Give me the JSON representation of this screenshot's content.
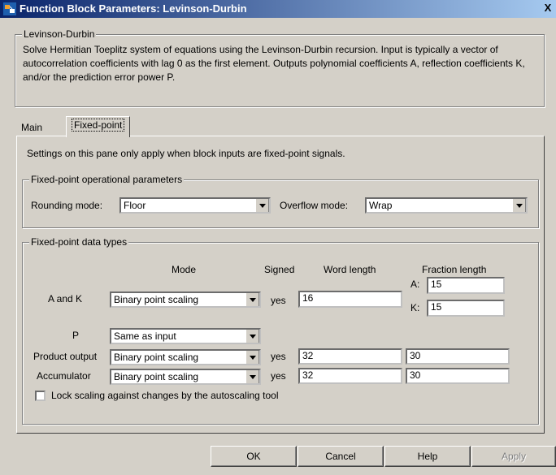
{
  "window": {
    "title": "Function Block Parameters: Levinson-Durbin",
    "close_glyph": "X"
  },
  "block": {
    "group_label": "Levinson-Durbin",
    "description": "Solve Hermitian Toeplitz system of equations using the Levinson-Durbin recursion.  Input is typically a vector of autocorrelation coefficients with lag 0 as the first element.  Outputs polynomial coefficients A, reflection coefficients K, and/or the prediction error power P."
  },
  "tabs": [
    {
      "label": "Main",
      "active": false
    },
    {
      "label": "Fixed-point",
      "active": true
    }
  ],
  "pane": {
    "note": "Settings on this pane only apply when block inputs are fixed-point signals."
  },
  "operational": {
    "group_label": "Fixed-point operational parameters",
    "rounding_label": "Rounding mode:",
    "rounding_value": "Floor",
    "overflow_label": "Overflow mode:",
    "overflow_value": "Wrap"
  },
  "datatypes": {
    "group_label": "Fixed-point data types",
    "headers": {
      "mode": "Mode",
      "signed": "Signed",
      "word_length": "Word length",
      "fraction_length": "Fraction length"
    },
    "rows": [
      {
        "label": "A and K",
        "mode": "Binary point scaling",
        "signed": "yes",
        "word_length": "16",
        "fraction_a_label": "A:",
        "fraction_a": "15",
        "fraction_k_label": "K:",
        "fraction_k": "15"
      },
      {
        "label": "P",
        "mode": "Same as input"
      },
      {
        "label": "Product output",
        "mode": "Binary point scaling",
        "signed": "yes",
        "word_length": "32",
        "fraction_length": "30"
      },
      {
        "label": "Accumulator",
        "mode": "Binary point scaling",
        "signed": "yes",
        "word_length": "32",
        "fraction_length": "30"
      }
    ],
    "lock_label": "Lock scaling against changes by the autoscaling tool",
    "lock_checked": false
  },
  "buttons": {
    "ok": "OK",
    "cancel": "Cancel",
    "help": "Help",
    "apply": "Apply"
  }
}
